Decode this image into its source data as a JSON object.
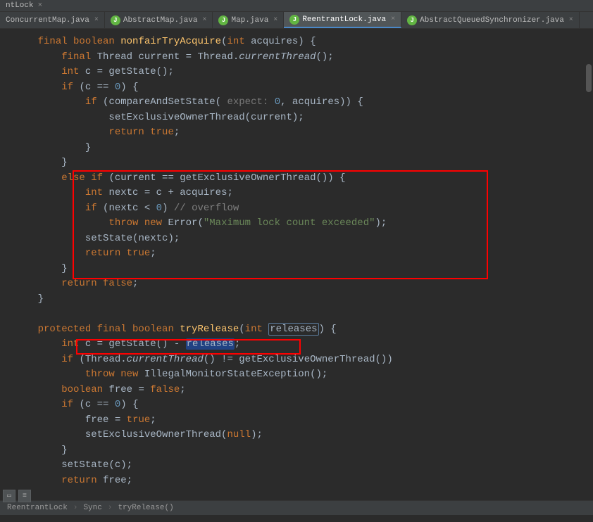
{
  "titleBar": {
    "text": "ntLock"
  },
  "tabs": [
    {
      "label": "ConcurrentMap.java",
      "active": false,
      "hasIcon": false
    },
    {
      "label": "AbstractMap.java",
      "active": false,
      "hasIcon": true
    },
    {
      "label": "Map.java",
      "active": false,
      "hasIcon": true
    },
    {
      "label": "ReentrantLock.java",
      "active": true,
      "hasIcon": true
    },
    {
      "label": "AbstractQueuedSynchronizer.java",
      "active": false,
      "hasIcon": true
    }
  ],
  "code": {
    "l1": {
      "indent": "    ",
      "kw1": "final boolean ",
      "fn": "nonfairTryAcquire",
      "p1": "(",
      "kw2": "int ",
      "p2": "acquires) {"
    },
    "l2": {
      "indent": "        ",
      "kw1": "final ",
      "t1": "Thread current = Thread.",
      "fn": "currentThread",
      "p1": "();"
    },
    "l3": {
      "indent": "        ",
      "kw1": "int ",
      "t1": "c = getState();"
    },
    "l4": {
      "indent": "        ",
      "kw1": "if ",
      "t1": "(c == ",
      "n1": "0",
      "t2": ") {"
    },
    "l5": {
      "indent": "            ",
      "kw1": "if ",
      "t1": "(compareAndSetState(",
      "h1": " expect: ",
      "n1": "0",
      "t2": ", acquires)) {"
    },
    "l6": {
      "indent": "                ",
      "t1": "setExclusiveOwnerThread(current);"
    },
    "l7": {
      "indent": "                ",
      "kw1": "return ",
      "kw2": "true",
      "t1": ";"
    },
    "l8": {
      "indent": "            ",
      "t1": "}"
    },
    "l9": {
      "indent": "        ",
      "t1": "}"
    },
    "l10": {
      "indent": "        ",
      "kw1": "else if ",
      "t1": "(current == getExclusiveOwnerThread()) {"
    },
    "l11": {
      "indent": "            ",
      "kw1": "int ",
      "t1": "nextc = c + acquires;"
    },
    "l12": {
      "indent": "            ",
      "kw1": "if ",
      "t1": "(nextc < ",
      "n1": "0",
      "t2": ") ",
      "c1": "// overflow"
    },
    "l13": {
      "indent": "                ",
      "kw1": "throw new ",
      "t1": "Error(",
      "s1": "\"Maximum lock count exceeded\"",
      "t2": ");"
    },
    "l14": {
      "indent": "            ",
      "t1": "setState(nextc);"
    },
    "l15": {
      "indent": "            ",
      "kw1": "return ",
      "kw2": "true",
      "t1": ";"
    },
    "l16": {
      "indent": "        ",
      "t1": "}"
    },
    "l17": {
      "indent": "        ",
      "kw1": "return ",
      "kw2": "false",
      "t1": ";"
    },
    "l18": {
      "indent": "    ",
      "t1": "}"
    },
    "l19": {
      "indent": "",
      "t1": ""
    },
    "l20": {
      "indent": "    ",
      "kw1": "protected final boolean ",
      "fn": "tryRelease",
      "p1": "(",
      "kw2": "int ",
      "hl": "releases",
      "p2": ") {"
    },
    "l21": {
      "indent": "        ",
      "kw1": "int ",
      "t1": "c = getState() - ",
      "hl": "releases",
      "t2": ";"
    },
    "l22": {
      "indent": "        ",
      "kw1": "if ",
      "t1": "(Thread.",
      "fn": "currentThread",
      "t2": "() != getExclusiveOwnerThread())"
    },
    "l23": {
      "indent": "            ",
      "kw1": "throw new ",
      "t1": "IllegalMonitorStateException();"
    },
    "l24": {
      "indent": "        ",
      "kw1": "boolean ",
      "t1": "free = ",
      "kw2": "false",
      "t2": ";"
    },
    "l25": {
      "indent": "        ",
      "kw1": "if ",
      "t1": "(c == ",
      "n1": "0",
      "t2": ") {"
    },
    "l26": {
      "indent": "            ",
      "t1": "free = ",
      "kw1": "true",
      "t2": ";"
    },
    "l27": {
      "indent": "            ",
      "t1": "setExclusiveOwnerThread(",
      "kw1": "null",
      "t2": ");"
    },
    "l28": {
      "indent": "        ",
      "t1": "}"
    },
    "l29": {
      "indent": "        ",
      "t1": "setState(c);"
    },
    "l30": {
      "indent": "        ",
      "kw1": "return ",
      "t1": "free;"
    }
  },
  "breadcrumbs": {
    "b1": "ReentrantLock",
    "b2": "Sync",
    "b3": "tryRelease()"
  }
}
